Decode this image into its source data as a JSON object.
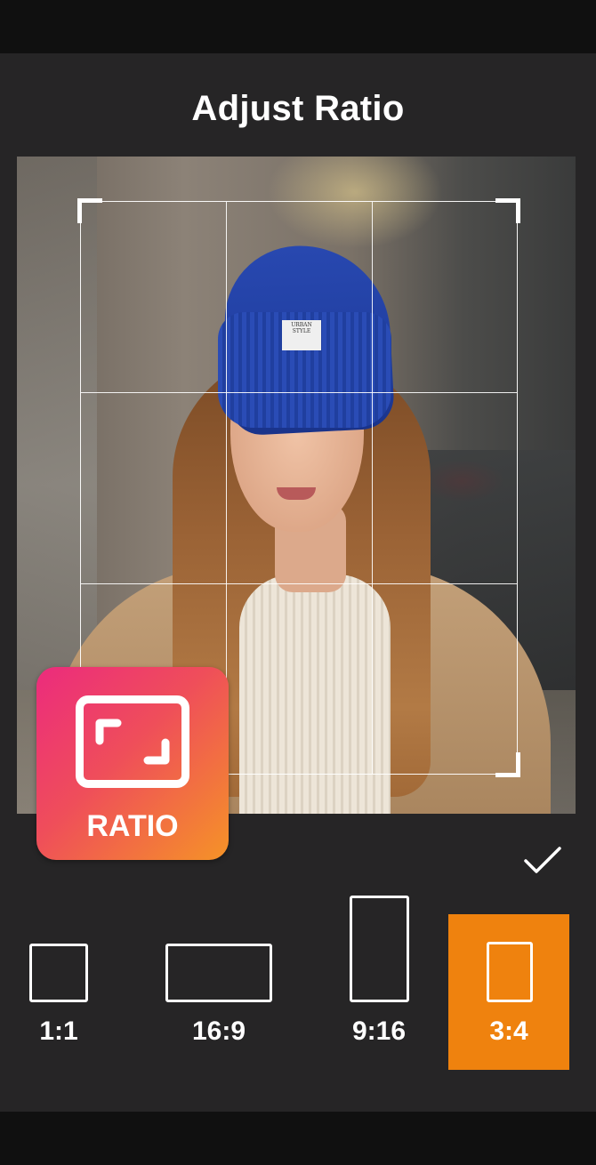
{
  "header": {
    "title": "Adjust Ratio"
  },
  "photo": {
    "hat_label": "URBAN STYLE"
  },
  "badge": {
    "label": "RATIO",
    "icon": "ratio-frame-icon",
    "gradient": [
      "#ec2b7d",
      "#f59327"
    ]
  },
  "confirm": {
    "icon": "checkmark-icon"
  },
  "ratios": [
    {
      "label": "1:1",
      "selected": false
    },
    {
      "label": "16:9",
      "selected": false
    },
    {
      "label": "9:16",
      "selected": false
    },
    {
      "label": "3:4",
      "selected": true
    }
  ],
  "colors": {
    "panel": "#262526",
    "accent": "#ef820e",
    "text": "#ffffff"
  }
}
